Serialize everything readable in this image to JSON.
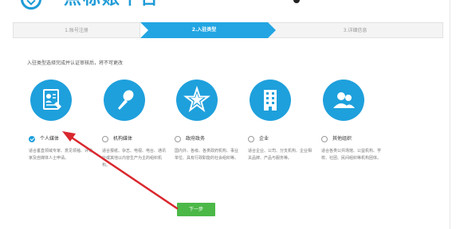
{
  "header": {
    "title": "点标账平台"
  },
  "steps": {
    "step1": "1.账号注册",
    "step2": "2.入驻类型",
    "step3": "3.详细信息"
  },
  "hint": "入驻类型选择完成并认证审核后，将不可更改",
  "options": [
    {
      "label": "个人媒体",
      "icon": "person-document-icon",
      "checked": true,
      "desc": "适合垂直领域专家、意见领袖、评论家及自媒体人士申请。"
    },
    {
      "label": "机构媒体",
      "icon": "microphone-icon",
      "checked": false,
      "desc": "适合报纸、杂志、电视、电台、通讯社或其他以内容生产为主的组织机构。"
    },
    {
      "label": "政府政务",
      "icon": "star-emblem-icon",
      "checked": false,
      "desc": "国内外、各级、各类政府机构、事业单位、具有行政职能的社会组织等。"
    },
    {
      "label": "企业",
      "icon": "building-icon",
      "checked": false,
      "desc": "适合企业、公司、分支机构、企业相关品牌、产品与服务等。"
    },
    {
      "label": "其他组织",
      "icon": "group-people-icon",
      "checked": false,
      "desc": "适合各类公共场馆、公益机构、学校、社团、民间组织等机构团体。"
    }
  ],
  "next_button": "下一步",
  "colors": {
    "primary": "#1ea0dc",
    "step_active": "#22a5e2",
    "button": "#4cb848",
    "arrow": "#d9272e"
  }
}
